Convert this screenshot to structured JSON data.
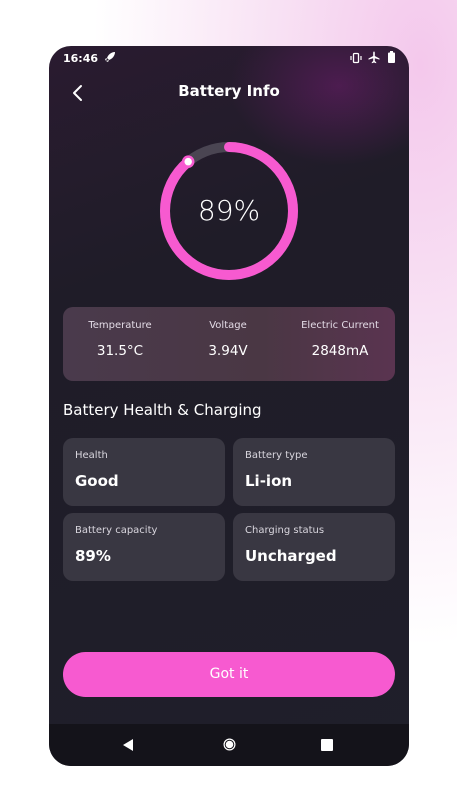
{
  "status_bar": {
    "time": "16:46",
    "icons": [
      "rocket-icon",
      "vibrate-icon",
      "airplane-icon",
      "battery-icon"
    ]
  },
  "header": {
    "title": "Battery Info",
    "back_icon": "chevron-left-icon"
  },
  "gauge": {
    "value_text": "89%",
    "level": 0.89,
    "accent_color": "#f75ad0",
    "track_color": "#4a4552"
  },
  "stats": [
    {
      "label": "Temperature",
      "value": "31.5°C"
    },
    {
      "label": "Voltage",
      "value": "3.94V"
    },
    {
      "label": "Electric Current",
      "value": "2848mA"
    }
  ],
  "section": {
    "heading": "Battery Health & Charging"
  },
  "tiles": [
    {
      "label": "Health",
      "value": "Good"
    },
    {
      "label": "Battery type",
      "value": "Li-ion"
    },
    {
      "label": "Battery capacity",
      "value": "89%"
    },
    {
      "label": "Charging status",
      "value": "Uncharged"
    }
  ],
  "action": {
    "label": "Got it",
    "color": "#f75ad0"
  },
  "nav_bar": {
    "icons": [
      "nav-back-icon",
      "nav-home-icon",
      "nav-recents-icon"
    ]
  }
}
